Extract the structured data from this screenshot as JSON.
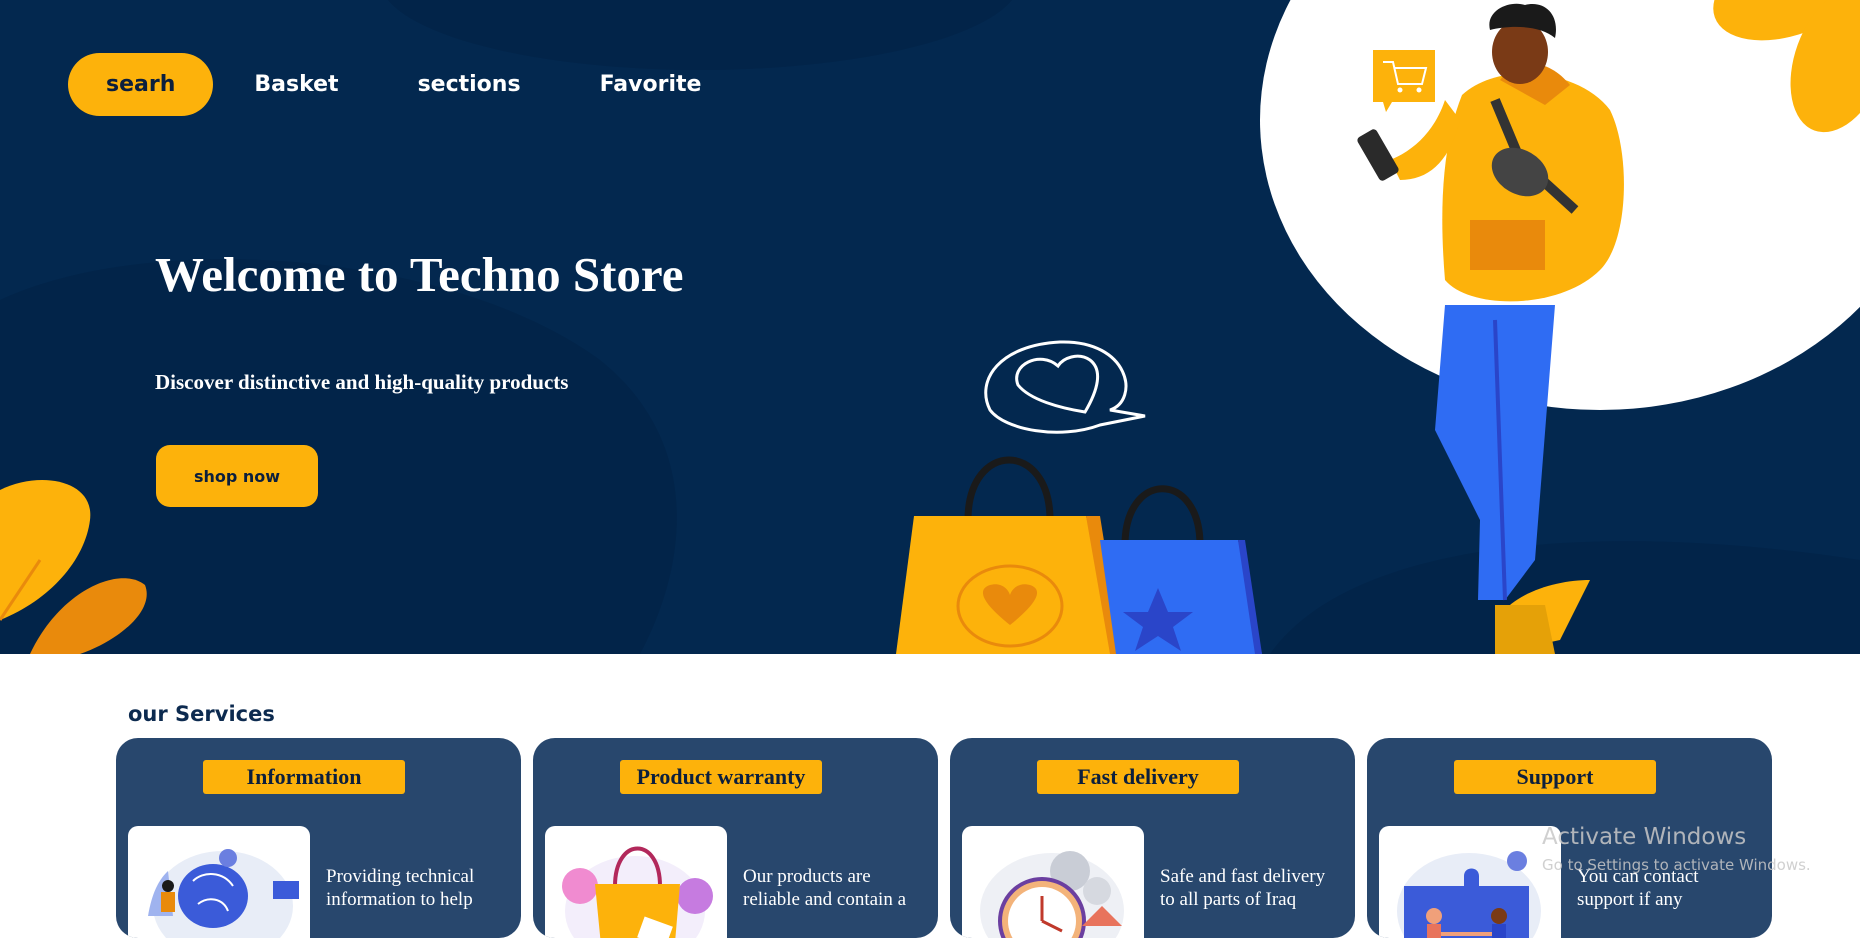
{
  "nav": {
    "items": [
      {
        "label": "searh",
        "active": true
      },
      {
        "label": "Basket",
        "active": false
      },
      {
        "label": "sections",
        "active": false
      },
      {
        "label": "Favorite",
        "active": false
      }
    ]
  },
  "hero": {
    "title": "Welcome to Techno Store",
    "subtitle": "Discover distinctive and high-quality products",
    "cta_label": "shop now"
  },
  "services": {
    "heading": "our Services",
    "cards": [
      {
        "title": "Information",
        "text": "Providing technical information to help",
        "icon": "brain-computer-illustration"
      },
      {
        "title": "Product warranty",
        "text": "Our products are reliable and contain a",
        "icon": "shopping-bag-illustration"
      },
      {
        "title": "Fast delivery",
        "text": "Safe and fast delivery to all parts of Iraq",
        "icon": "clock-gears-illustration"
      },
      {
        "title": "Support",
        "text": "You can contact support if any",
        "icon": "puzzle-handshake-illustration"
      }
    ]
  },
  "watermark": {
    "line1": "Activate Windows",
    "line2": "Go to Settings to activate Windows."
  },
  "colors": {
    "navy": "#03284f",
    "accent": "#fdb20b",
    "card": "#28476d",
    "blue": "#2f6cf3"
  },
  "icons": [
    "cart-bubble-icon",
    "heart-bubble-icon",
    "shopping-bags",
    "person-with-phone",
    "leaf-decoration"
  ]
}
